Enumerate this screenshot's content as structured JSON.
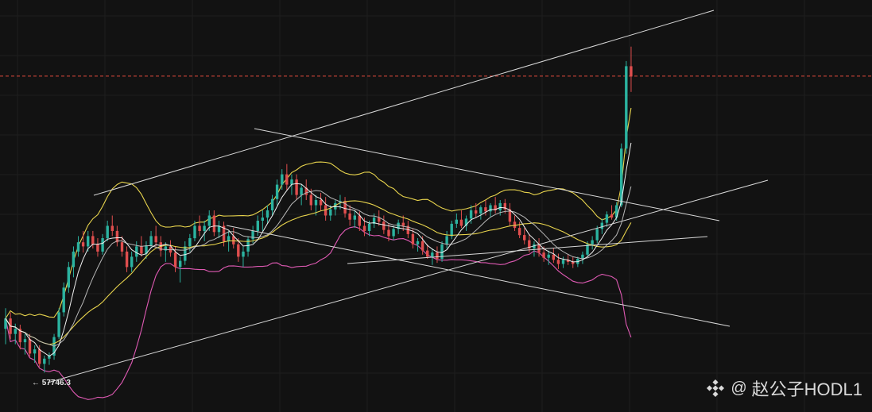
{
  "chart_data": {
    "type": "candlestick",
    "low_marker": {
      "arrow": "←",
      "value": "57746.3"
    },
    "price_range": [
      55000,
      92000
    ],
    "current_price_line": "dashed red",
    "colors": {
      "background": "#121212",
      "up": "#2bb3a0",
      "down": "#e04e4e",
      "bb_upper": "#e8d44d",
      "bb_lower": "#e05ab4",
      "ma_fast": "#f0f0f0",
      "ma_mid": "#b8b8b8",
      "ma_slow": "#e8d44d",
      "trendline": "#d8d8d8",
      "current_price": "#e0483c"
    },
    "candles": [
      [
        62000,
        64000,
        60500,
        63000
      ],
      [
        63000,
        63600,
        61000,
        61500
      ],
      [
        61500,
        62500,
        60500,
        62000
      ],
      [
        62000,
        62400,
        60000,
        60700
      ],
      [
        60700,
        61500,
        59500,
        61000
      ],
      [
        61000,
        61500,
        59300,
        59600
      ],
      [
        59600,
        60400,
        58700,
        60000
      ],
      [
        60000,
        60400,
        58300,
        58600
      ],
      [
        58600,
        59400,
        57746,
        59100
      ],
      [
        59100,
        59700,
        58500,
        59400
      ],
      [
        59400,
        61500,
        59000,
        61200
      ],
      [
        61200,
        64000,
        61000,
        63600
      ],
      [
        63600,
        66500,
        63200,
        66000
      ],
      [
        66000,
        68500,
        65500,
        68000
      ],
      [
        68000,
        70000,
        67000,
        69500
      ],
      [
        69500,
        71000,
        69000,
        70400
      ],
      [
        70400,
        71500,
        69400,
        70000
      ],
      [
        70000,
        71500,
        69500,
        71000
      ],
      [
        71000,
        71500,
        69800,
        70200
      ],
      [
        70200,
        70800,
        69000,
        69500
      ],
      [
        69500,
        71200,
        69200,
        70800
      ],
      [
        70800,
        72500,
        70500,
        72000
      ],
      [
        72000,
        73000,
        71000,
        71500
      ],
      [
        71500,
        72000,
        70000,
        70400
      ],
      [
        70400,
        71000,
        69000,
        69500
      ],
      [
        69500,
        70000,
        67500,
        68000
      ],
      [
        68000,
        69500,
        67500,
        69000
      ],
      [
        69000,
        70500,
        68500,
        70000
      ],
      [
        70000,
        71000,
        69000,
        69300
      ],
      [
        69300,
        70500,
        68800,
        70100
      ],
      [
        70100,
        71500,
        69800,
        71000
      ],
      [
        71000,
        72000,
        70000,
        70400
      ],
      [
        70400,
        71000,
        69000,
        69600
      ],
      [
        69600,
        70400,
        68500,
        70000
      ],
      [
        70000,
        70600,
        69000,
        69400
      ],
      [
        69400,
        70000,
        67500,
        68000
      ],
      [
        68000,
        69000,
        66500,
        68600
      ],
      [
        68600,
        70500,
        68200,
        70000
      ],
      [
        70000,
        71200,
        69500,
        70800
      ],
      [
        70800,
        72500,
        70500,
        72000
      ],
      [
        72000,
        73000,
        71000,
        71500
      ],
      [
        71500,
        72500,
        70500,
        72000
      ],
      [
        72000,
        73500,
        71500,
        73000
      ],
      [
        73000,
        73500,
        71000,
        71400
      ],
      [
        71400,
        72500,
        70800,
        72000
      ],
      [
        72000,
        72400,
        70000,
        70500
      ],
      [
        70500,
        71500,
        69500,
        71000
      ],
      [
        71000,
        71800,
        69800,
        70200
      ],
      [
        70200,
        70800,
        68500,
        69000
      ],
      [
        69000,
        70000,
        68000,
        69500
      ],
      [
        69500,
        71000,
        69000,
        70700
      ],
      [
        70700,
        72000,
        70300,
        71500
      ],
      [
        71500,
        73000,
        71000,
        72500
      ],
      [
        72500,
        73500,
        71500,
        72800
      ],
      [
        72800,
        74000,
        72200,
        73500
      ],
      [
        73500,
        75000,
        73000,
        74600
      ],
      [
        74600,
        76500,
        74000,
        76000
      ],
      [
        76000,
        77500,
        75500,
        77000
      ],
      [
        77000,
        78000,
        75500,
        76000
      ],
      [
        76000,
        77000,
        75000,
        76500
      ],
      [
        76500,
        77000,
        74500,
        75000
      ],
      [
        75000,
        76000,
        74000,
        75700
      ],
      [
        75700,
        76500,
        74500,
        75000
      ],
      [
        75000,
        75600,
        73500,
        74000
      ],
      [
        74000,
        75000,
        73000,
        74500
      ],
      [
        74500,
        75200,
        73500,
        74000
      ],
      [
        74000,
        74800,
        72500,
        73000
      ],
      [
        73000,
        74000,
        72500,
        73600
      ],
      [
        73600,
        74500,
        73000,
        74200
      ],
      [
        74200,
        75000,
        73600,
        74400
      ],
      [
        74400,
        74800,
        72800,
        73200
      ],
      [
        73200,
        74000,
        72000,
        72600
      ],
      [
        72600,
        73500,
        71800,
        73000
      ],
      [
        73000,
        73400,
        71500,
        72000
      ],
      [
        72000,
        72800,
        71000,
        71500
      ],
      [
        71500,
        72500,
        71000,
        72200
      ],
      [
        72200,
        73200,
        71800,
        72800
      ],
      [
        72800,
        73500,
        72000,
        72400
      ],
      [
        72400,
        73000,
        71200,
        71600
      ],
      [
        71600,
        72200,
        70500,
        71000
      ],
      [
        71000,
        72000,
        70600,
        71700
      ],
      [
        71700,
        72600,
        71200,
        72300
      ],
      [
        72300,
        73000,
        71500,
        72000
      ],
      [
        72000,
        72500,
        70800,
        71200
      ],
      [
        71200,
        71700,
        69800,
        70200
      ],
      [
        70200,
        70800,
        69500,
        70500
      ],
      [
        70500,
        71000,
        69200,
        69600
      ],
      [
        69600,
        70200,
        68800,
        69000
      ],
      [
        69000,
        69800,
        68200,
        69400
      ],
      [
        69400,
        70000,
        68400,
        68800
      ],
      [
        68800,
        70500,
        68500,
        70200
      ],
      [
        70200,
        71500,
        69800,
        71000
      ],
      [
        71000,
        72500,
        70700,
        72200
      ],
      [
        72200,
        73200,
        71800,
        72600
      ],
      [
        72600,
        73500,
        71800,
        72000
      ],
      [
        72000,
        73000,
        71500,
        72700
      ],
      [
        72700,
        74000,
        72200,
        73500
      ],
      [
        73500,
        74200,
        72800,
        73200
      ],
      [
        73200,
        74000,
        72600,
        73800
      ],
      [
        73800,
        74500,
        73000,
        73400
      ],
      [
        73400,
        74200,
        72900,
        74000
      ],
      [
        74000,
        74800,
        73200,
        73500
      ],
      [
        73500,
        74500,
        73000,
        74200
      ],
      [
        74200,
        74600,
        73200,
        73600
      ],
      [
        73600,
        74200,
        72000,
        72400
      ],
      [
        72400,
        73000,
        71500,
        71800
      ],
      [
        71800,
        72400,
        70800,
        71100
      ],
      [
        71100,
        71800,
        70200,
        70600
      ],
      [
        70600,
        71200,
        69400,
        69800
      ],
      [
        69800,
        70500,
        69000,
        70200
      ],
      [
        70200,
        70800,
        69000,
        69400
      ],
      [
        69400,
        70000,
        68500,
        68900
      ],
      [
        68900,
        69600,
        68200,
        69200
      ],
      [
        69200,
        69800,
        68400,
        68700
      ],
      [
        68700,
        69300,
        67800,
        68300
      ],
      [
        68300,
        69000,
        67900,
        68700
      ],
      [
        68700,
        69200,
        68200,
        68500
      ],
      [
        68500,
        69000,
        67900,
        68300
      ],
      [
        68300,
        69000,
        68000,
        68800
      ],
      [
        68800,
        69500,
        68300,
        69200
      ],
      [
        69200,
        70500,
        69000,
        70200
      ],
      [
        70200,
        71000,
        69700,
        70600
      ],
      [
        70600,
        72000,
        70300,
        71700
      ],
      [
        71700,
        72700,
        71200,
        72300
      ],
      [
        72300,
        73400,
        71900,
        73100
      ],
      [
        73100,
        74000,
        72600,
        72800
      ],
      [
        72800,
        74300,
        72500,
        74000
      ],
      [
        74000,
        80000,
        73800,
        79500
      ],
      [
        79500,
        88000,
        79000,
        87500
      ],
      [
        87500,
        89400,
        85000,
        86500
      ]
    ]
  },
  "watermark": {
    "at": "@",
    "text": "赵公子HODL1",
    "logo_icon": "binance-diamond-icon"
  }
}
